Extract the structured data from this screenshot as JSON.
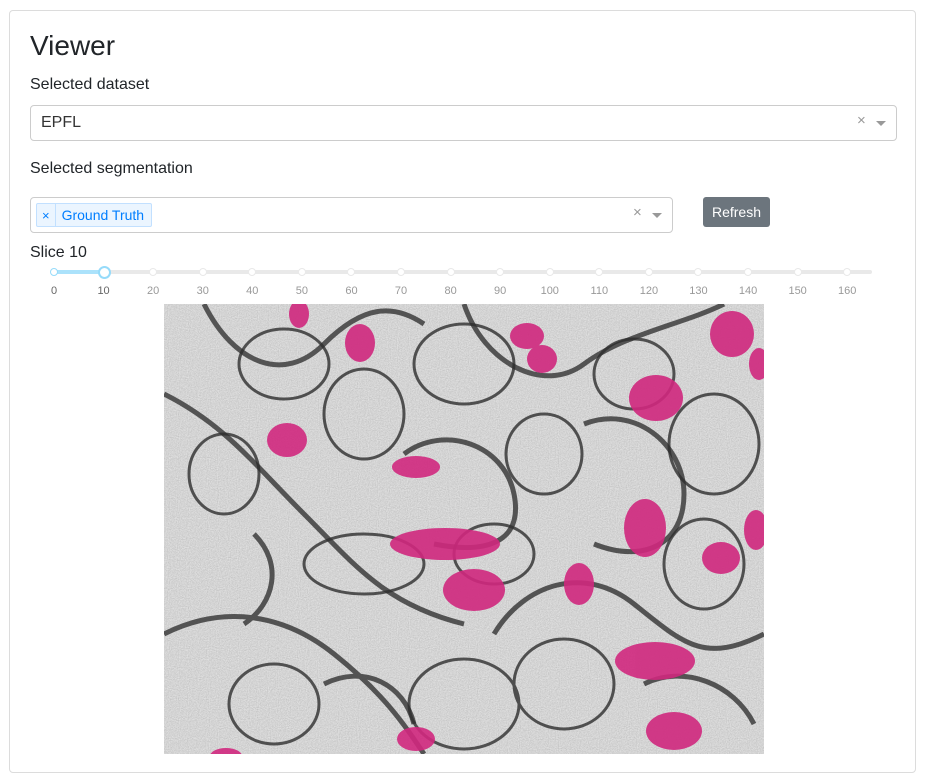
{
  "page": {
    "title": "Viewer"
  },
  "dataset": {
    "label": "Selected dataset",
    "value": "EPFL",
    "clear": "×"
  },
  "segmentation": {
    "label": "Selected segmentation",
    "tags": [
      "Ground Truth"
    ],
    "tag_remove": "×",
    "clear": "×"
  },
  "refresh_button": "Refresh",
  "slice": {
    "label": "Slice 10",
    "value": 10,
    "min": 0,
    "max": 165,
    "marks": [
      "0",
      "10",
      "20",
      "30",
      "40",
      "50",
      "60",
      "70",
      "80",
      "90",
      "100",
      "110",
      "120",
      "130",
      "140",
      "150",
      "160"
    ]
  },
  "image": {
    "overlay_color": "#d0287e",
    "background": "#a8a8a8"
  }
}
